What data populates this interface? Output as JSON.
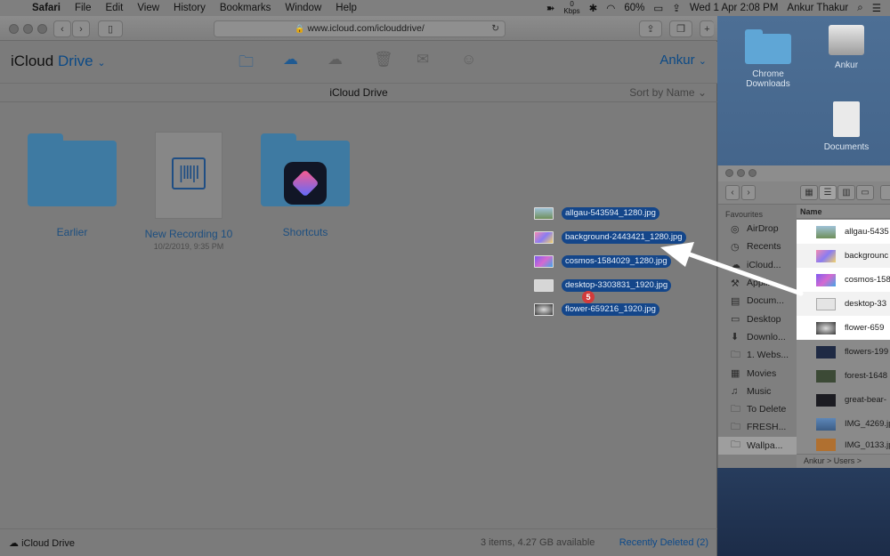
{
  "menubar": {
    "app": "Safari",
    "menus": [
      "File",
      "Edit",
      "View",
      "History",
      "Bookmarks",
      "Window",
      "Help"
    ],
    "net_up": "0",
    "net_down": "Kbps",
    "battery": "60%",
    "datetime": "Wed 1 Apr  2:08 PM",
    "user": "Ankur Thakur"
  },
  "safari": {
    "url": "www.icloud.com/iclouddrive/",
    "app_title_prefix": "iCloud",
    "app_title_suffix": "Drive",
    "account": "Ankur",
    "path_title": "iCloud Drive",
    "sort_label": "Sort by Name",
    "items": [
      {
        "label": "Earlier",
        "sub": ""
      },
      {
        "label": "New Recording 10",
        "sub": "10/2/2019, 9:35 PM"
      },
      {
        "label": "Shortcuts",
        "sub": ""
      }
    ],
    "status_left": "iCloud Drive",
    "status_count": "3 items, 4.27 GB available",
    "status_deleted": "Recently Deleted (2)"
  },
  "drag": {
    "files": [
      "allgau-543594_1280.jpg",
      "background-2443421_1280.jpg",
      "cosmos-1584029_1280.jpg",
      "desktop-3303831_1920.jpg",
      "flower-659216_1920.jpg"
    ],
    "badge": "5"
  },
  "desktop": {
    "icons": [
      "Chrome Downloads",
      "Ankur",
      "Documents"
    ]
  },
  "finder": {
    "favourites_label": "Favourites",
    "sidebar": [
      "AirDrop",
      "Recents",
      "iCloud...",
      "Appli...",
      "Docum...",
      "Desktop",
      "Downlo...",
      "1. Webs...",
      "Movies",
      "Music",
      "To Delete",
      "FRESH...",
      "Wallpa..."
    ],
    "column_name": "Name",
    "files": [
      "allgau-5435",
      "backgrounc",
      "cosmos-158",
      "desktop-33",
      "flower-659",
      "flowers-199",
      "forest-1648",
      "great-bear-",
      "IMG_4269.jp",
      "IMG_0133.jp"
    ],
    "path": "Ankur > Users >"
  },
  "colors": {
    "accent": "#0c4a86",
    "badge": "#d23b3b",
    "selection": "#14468a"
  }
}
